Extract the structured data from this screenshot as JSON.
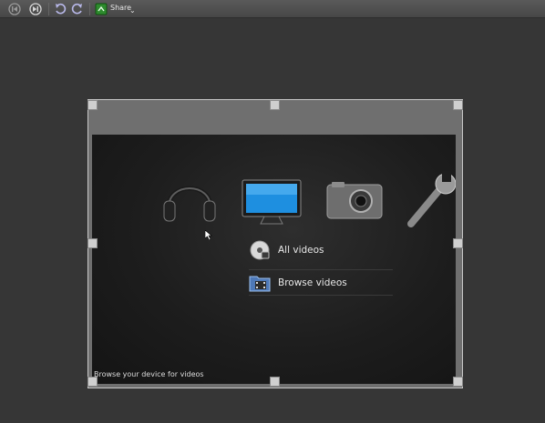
{
  "toolbar": {
    "share_label": "Share",
    "buttons": [
      "prev-icon",
      "next-icon",
      "rotate-left-icon",
      "rotate-right-icon",
      "share-icon"
    ]
  },
  "screen": {
    "category_icons": [
      "headphones-icon",
      "tv-icon",
      "camera-icon",
      "wrench-icon"
    ],
    "menu": [
      {
        "label": "All videos",
        "icon": "video-disc-icon"
      },
      {
        "label": "Browse videos",
        "icon": "film-folder-icon"
      }
    ],
    "footer": "Browse your device for videos"
  },
  "colors": {
    "accent_tv": "#1e8fe0",
    "share_green": "#2e8b2e"
  }
}
